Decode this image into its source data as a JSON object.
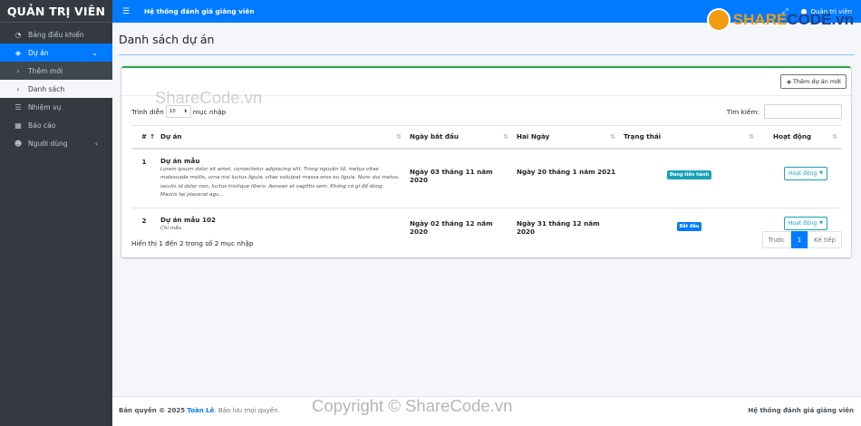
{
  "sidebar": {
    "brand": "QUẢN TRỊ VIÊN",
    "items": [
      {
        "label": "Bảng điều khiển",
        "icon": "tachometer-icon"
      },
      {
        "label": "Dự án",
        "icon": "layers-icon"
      },
      {
        "label": "Thêm mới",
        "icon": "chevron-right-icon"
      },
      {
        "label": "Danh sách",
        "icon": "chevron-right-icon"
      },
      {
        "label": "Nhiệm vụ",
        "icon": "tasks-icon"
      },
      {
        "label": "Báo cáo",
        "icon": "table-icon"
      },
      {
        "label": "Người dùng",
        "icon": "users-icon"
      }
    ]
  },
  "topbar": {
    "title": "Hệ thống đánh giá giảng viên",
    "user": "Quản trị viên"
  },
  "logo": {
    "part1": "SHARE",
    "part2": "CODE",
    "suffix": ".vn"
  },
  "page": {
    "title": "Danh sách dự án"
  },
  "card": {
    "add_button": "Thêm dự án mới",
    "length_prefix": "Trình diễn",
    "length_value": "10",
    "length_suffix": "mục nhập",
    "search_label": "Tìm kiếm:",
    "watermark": "ShareCode.vn"
  },
  "table": {
    "headers": [
      "#",
      "Dự án",
      "Ngày bắt đầu",
      "Hai Ngày",
      "Trạng thái",
      "Hoạt động"
    ],
    "rows": [
      {
        "num": "1",
        "name": "Dự án mẫu",
        "desc": "Lorem ipsum dolor sit amet, consectetur adipiscing elit. Trong nguyện tố, metus vitae malesuada mollis, urna nisi luctus ligula, vitae volutpat massa eros eu ligula. Nunc dui metus, iaculis id dolor non, luctus tristique libero. Aenean et sagittis sem. Không có gì để dòng. Mauris tại placerat agu...",
        "start": "Ngày 03 tháng 11 năm 2020",
        "end": "Ngày 20 tháng 1 năm 2021",
        "status": "Đang tiến hành",
        "action": "Hoạt động"
      },
      {
        "num": "2",
        "name": "Dự án mẫu 102",
        "desc": "Chỉ mẫu",
        "start": "Ngày 02 tháng 12 năm 2020",
        "end": "Ngày 31 tháng 12 năm 2020",
        "status": "Bắt đầu",
        "action": "Hoạt động"
      }
    ]
  },
  "pagination": {
    "info": "Hiển thị 1 đến 2 trong số 2 mục nhập",
    "prev": "Trước",
    "current": "1",
    "next": "Kế tiếp"
  },
  "footer": {
    "copyright_label": "Bản quyền © 2025",
    "author": "Toàn Lê",
    "rights": ". Bảo lưu mọi quyền.",
    "right_text": "Hệ thống đánh giá giảng viên",
    "watermark": "Copyright © ShareCode.vn"
  },
  "colors": {
    "primary": "#007bff",
    "sidebar": "#343a40",
    "success": "#28a745",
    "info": "#17a2b8"
  }
}
